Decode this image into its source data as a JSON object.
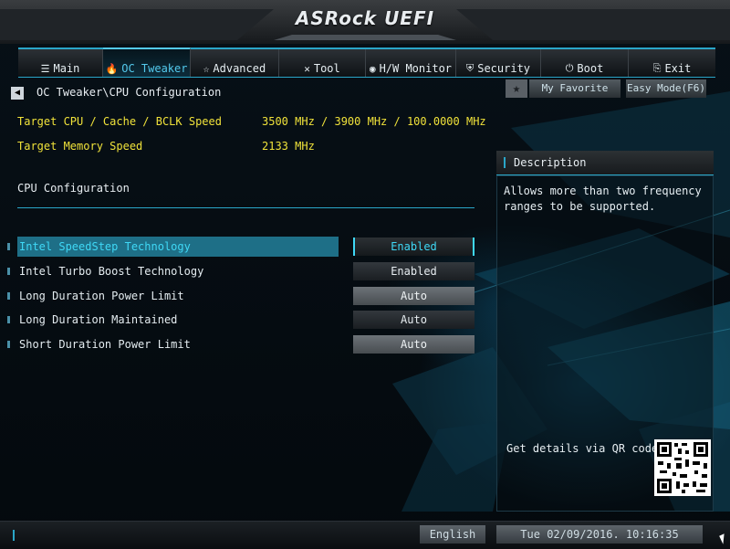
{
  "header": {
    "logo": "ASRock UEFI"
  },
  "tabs": [
    {
      "label": "Main",
      "icon": "☰"
    },
    {
      "label": "OC Tweaker",
      "icon": "🔥"
    },
    {
      "label": "Advanced",
      "icon": "☆"
    },
    {
      "label": "Tool",
      "icon": "✕"
    },
    {
      "label": "H/W Monitor",
      "icon": "◉"
    },
    {
      "label": "Security",
      "icon": "⛨"
    },
    {
      "label": "Boot",
      "icon": "⏻"
    },
    {
      "label": "Exit",
      "icon": "⎘"
    }
  ],
  "active_tab": "OC Tweaker",
  "breadcrumb": "OC Tweaker\\CPU Configuration",
  "favorite_label": "My Favorite",
  "easy_mode_label": "Easy Mode(F6)",
  "info": [
    {
      "label": "Target CPU / Cache / BCLK Speed",
      "value": "3500 MHz / 3900 MHz / 100.0000 MHz"
    },
    {
      "label": "Target Memory Speed",
      "value": "2133 MHz"
    }
  ],
  "section_title": "CPU Configuration",
  "settings": [
    {
      "label": "Intel SpeedStep Technology",
      "value": "Enabled"
    },
    {
      "label": "Intel Turbo Boost Technology",
      "value": "Enabled"
    },
    {
      "label": "Long Duration Power Limit",
      "value": "Auto"
    },
    {
      "label": "Long Duration Maintained",
      "value": "Auto"
    },
    {
      "label": "Short Duration Power Limit",
      "value": "Auto"
    }
  ],
  "description": {
    "title": "Description",
    "text": "Allows more than two frequency ranges to be supported.",
    "qr_label": "Get details via QR code"
  },
  "footer": {
    "language": "English",
    "datetime": "Tue 02/09/2016. 10:16:35"
  },
  "colors": {
    "accent": "#2aa6c8",
    "highlight": "#3fd8f6",
    "info_text": "#f0e23a"
  }
}
